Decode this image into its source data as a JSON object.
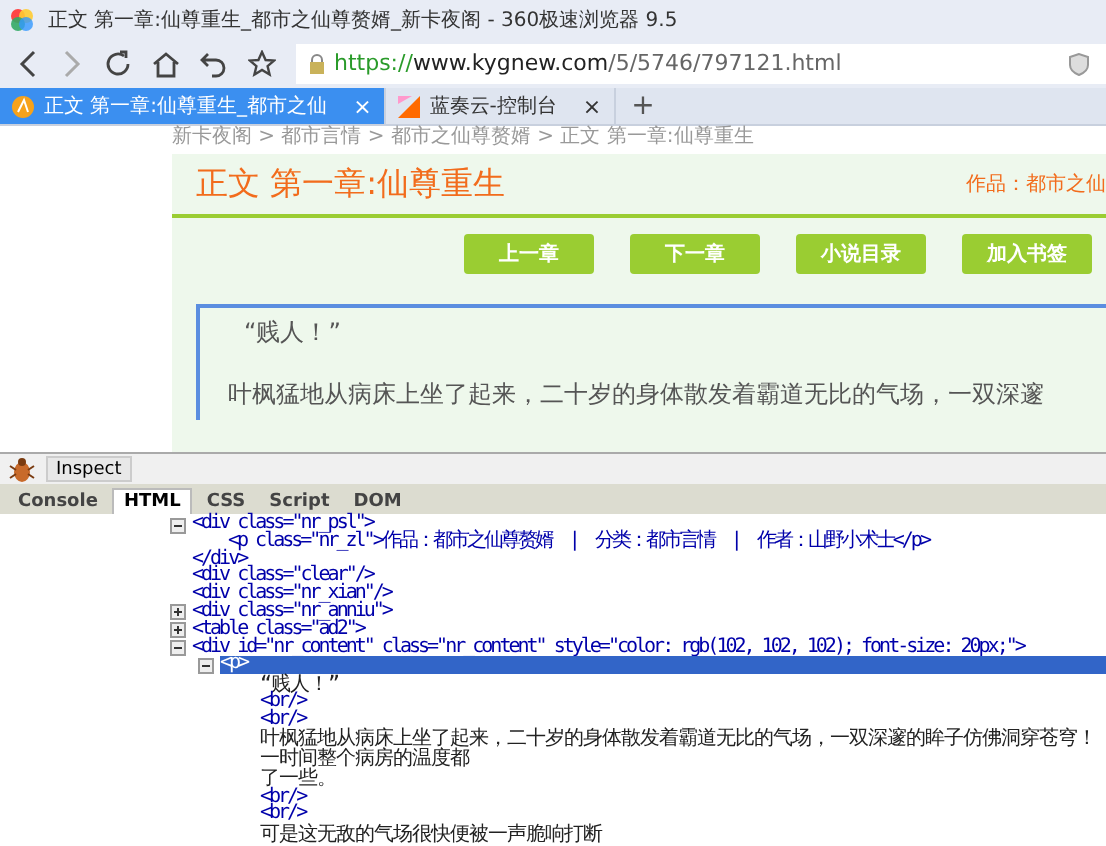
{
  "window": {
    "title": "正文 第一章:仙尊重生_都市之仙尊赘婿_新卡夜阁 - 360极速浏览器 9.5"
  },
  "address_bar": {
    "scheme": "https://",
    "host": "www.kygnew.com",
    "path": "/5/5746/797121.html"
  },
  "tabs": [
    {
      "label": "正文 第一章:仙尊重生_都市之仙",
      "selected": true,
      "close": "×"
    },
    {
      "label": "蓝奏云-控制台",
      "selected": false,
      "close": "×"
    }
  ],
  "new_tab": "+",
  "page": {
    "breadcrumb": "新卡夜阁 > 都市言情 > 都市之仙尊赘婿 > 正文 第一章:仙尊重生",
    "chapter_title": "正文 第一章:仙尊重生",
    "meta": "作品：都市之仙",
    "buttons": [
      "上一章",
      "下一章",
      "小说目录",
      "加入书签"
    ],
    "paragraphs": [
      "“贱人！”",
      "叶枫猛地从病床上坐了起来，二十岁的身体散发着霸道无比的气场，一双深邃"
    ]
  },
  "devtools": {
    "inspect": "Inspect",
    "tabs": [
      {
        "label": "Console",
        "selected": false
      },
      {
        "label": "HTML",
        "selected": true
      },
      {
        "label": "CSS",
        "selected": false
      },
      {
        "label": "Script",
        "selected": false
      },
      {
        "label": "DOM",
        "selected": false
      }
    ],
    "tree": [
      {
        "kind": "tag",
        "html": "<div class=\"nr_psl\">",
        "expanded": true,
        "selected": false,
        "children": [
          {
            "kind": "tag",
            "html": "<p class=\"nr_zl\">作品：都市之仙尊赘婿　|　分类：都市言情　|　作者：山野小术士</p>",
            "selected": false
          }
        ]
      },
      {
        "kind": "tag",
        "html": "</div>",
        "selected": false
      },
      {
        "kind": "tag",
        "html": "<div class=\"clear\"/>",
        "selected": false
      },
      {
        "kind": "tag",
        "html": "<div class=\"nr_xian\"/>",
        "selected": false
      },
      {
        "kind": "tag",
        "html": "<div class=\"nr_anniu\">",
        "expanded": false,
        "selected": false
      },
      {
        "kind": "tag",
        "html": "<table class=\"ad2\">",
        "expanded": false,
        "selected": false
      },
      {
        "kind": "tag",
        "html": "<div id=\"nr_content\" class=\"nr_content\" style=\"color: rgb(102, 102, 102); font-size: 20px;\">",
        "expanded": true,
        "selected": false,
        "children": [
          {
            "kind": "tag",
            "html": "<p>",
            "expanded": true,
            "selected": true,
            "children": [
              {
                "kind": "text",
                "html": "“贱人！”",
                "selected": false
              },
              {
                "kind": "tag",
                "html": "<br/>",
                "selected": false
              },
              {
                "kind": "tag",
                "html": "<br/>",
                "selected": false
              },
              {
                "kind": "text",
                "html": "叶枫猛地从病床上坐了起来，二十岁的身体散发着霸道无比的气场，一双深邃的眸子仿佛洞穿苍穹！一时间整个病房的温度都",
                "selected": false
              },
              {
                "kind": "text",
                "html": "了一些。",
                "selected": false
              },
              {
                "kind": "tag",
                "html": "<br/>",
                "selected": false
              },
              {
                "kind": "tag",
                "html": "<br/>",
                "selected": false
              },
              {
                "kind": "text",
                "html": "可是这无敌的气场很快便被一声脆响打断",
                "selected": false
              }
            ]
          }
        ]
      }
    ]
  }
}
